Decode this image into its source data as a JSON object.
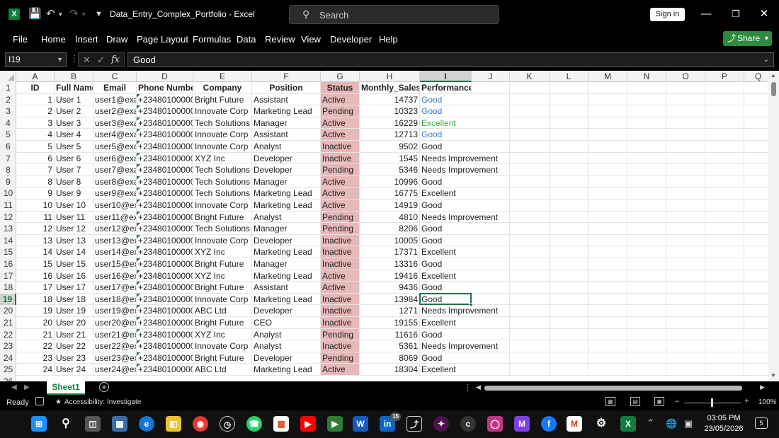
{
  "window": {
    "title": "Data_Entry_Complex_Portfolio  -  Excel",
    "search_placeholder": "Search",
    "signin_label": "Sign in"
  },
  "ribbon": {
    "tabs": [
      "File",
      "Home",
      "Insert",
      "Draw",
      "Page Layout",
      "Formulas",
      "Data",
      "Review",
      "View",
      "Developer",
      "Help"
    ],
    "share_label": "Share"
  },
  "formula_bar": {
    "name_box": "I19",
    "formula": "Good"
  },
  "columns": [
    "A",
    "B",
    "C",
    "D",
    "E",
    "F",
    "G",
    "H",
    "I",
    "J",
    "K",
    "L",
    "M",
    "N",
    "O",
    "P",
    "Q"
  ],
  "selected_column": "I",
  "selected_row": 19,
  "headers": [
    "ID",
    "Full Name",
    "Email",
    "Phone Number",
    "Company",
    "Position",
    "Status",
    "Monthly_Sales",
    "Performance"
  ],
  "rows": [
    [
      "1",
      "User 1",
      "user1@exa",
      "+23480100000(",
      "Bright Future",
      "Assistant",
      "Active",
      "14737",
      "Good"
    ],
    [
      "2",
      "User 2",
      "user2@exa",
      "+23480100000(",
      "Innovate Corp",
      "Marketing Lead",
      "Pending",
      "10323",
      "Good"
    ],
    [
      "3",
      "User 3",
      "user3@exa",
      "+23480100000(",
      "Tech Solutions",
      "Manager",
      "Active",
      "16229",
      "Excellent"
    ],
    [
      "4",
      "User 4",
      "user4@exa",
      "+23480100000(",
      "Innovate Corp",
      "Assistant",
      "Active",
      "12713",
      "Good"
    ],
    [
      "5",
      "User 5",
      "user5@exa",
      "+23480100000(",
      "Innovate Corp",
      "Analyst",
      "Inactive",
      "9502",
      "Good"
    ],
    [
      "6",
      "User 6",
      "user6@exa",
      "+23480100000(",
      "XYZ Inc",
      "Developer",
      "Inactive",
      "1545",
      "Needs Improvement"
    ],
    [
      "7",
      "User 7",
      "user7@exa",
      "+23480100000(",
      "Tech Solutions",
      "Developer",
      "Pending",
      "5346",
      "Needs Improvement"
    ],
    [
      "8",
      "User 8",
      "user8@exa",
      "+23480100000(",
      "Tech Solutions",
      "Manager",
      "Active",
      "10996",
      "Good"
    ],
    [
      "9",
      "User 9",
      "user9@exa",
      "+23480100000(",
      "Tech Solutions",
      "Marketing Lead",
      "Active",
      "16775",
      "Excellent"
    ],
    [
      "10",
      "User 10",
      "user10@ex",
      "+23480100000:",
      "Innovate Corp",
      "Marketing Lead",
      "Active",
      "14919",
      "Good"
    ],
    [
      "11",
      "User 11",
      "user11@ex",
      "+23480100000:",
      "Bright Future",
      "Analyst",
      "Pending",
      "4810",
      "Needs Improvement"
    ],
    [
      "12",
      "User 12",
      "user12@ex",
      "+23480100000:",
      "Tech Solutions",
      "Manager",
      "Pending",
      "8206",
      "Good"
    ],
    [
      "13",
      "User 13",
      "user13@ex",
      "+23480100000:",
      "Innovate Corp",
      "Developer",
      "Inactive",
      "10005",
      "Good"
    ],
    [
      "14",
      "User 14",
      "user14@ex",
      "+23480100000:",
      "XYZ Inc",
      "Marketing Lead",
      "Inactive",
      "17371",
      "Excellent"
    ],
    [
      "15",
      "User 15",
      "user15@ex",
      "+23480100000:",
      "Bright Future",
      "Manager",
      "Inactive",
      "13316",
      "Good"
    ],
    [
      "16",
      "User 16",
      "user16@ex",
      "+23480100000:",
      "XYZ Inc",
      "Marketing Lead",
      "Active",
      "19416",
      "Excellent"
    ],
    [
      "17",
      "User 17",
      "user17@ex",
      "+23480100000:",
      "Bright Future",
      "Assistant",
      "Active",
      "9436",
      "Good"
    ],
    [
      "18",
      "User 18",
      "user18@ex",
      "+23480100000:",
      "Innovate Corp",
      "Marketing Lead",
      "Inactive",
      "13984",
      "Good"
    ],
    [
      "19",
      "User 19",
      "user19@ex",
      "+23480100000:",
      "ABC Ltd",
      "Developer",
      "Inactive",
      "1271",
      "Needs Improvement"
    ],
    [
      "20",
      "User 20",
      "user20@ex",
      "+23480100000:",
      "Bright Future",
      "CEO",
      "Inactive",
      "19155",
      "Excellent"
    ],
    [
      "21",
      "User 21",
      "user21@ex",
      "+23480100000:",
      "XYZ Inc",
      "Analyst",
      "Pending",
      "11616",
      "Good"
    ],
    [
      "22",
      "User 22",
      "user22@ex",
      "+23480100000:",
      "Innovate Corp",
      "Analyst",
      "Inactive",
      "5361",
      "Needs Improvement"
    ],
    [
      "23",
      "User 23",
      "user23@ex",
      "+23480100000:",
      "Bright Future",
      "Developer",
      "Pending",
      "8069",
      "Good"
    ],
    [
      "24",
      "User 24",
      "user24@ex",
      "+23480100000:",
      "ABC Ltd",
      "Marketing Lead",
      "Active",
      "18304",
      "Excellent"
    ]
  ],
  "performance_colors": {
    "Good_top": "#3b7dc4",
    "Excellent_top": "#3aa84a"
  },
  "status_fill": "#e6b8b7",
  "sheet_tabs": [
    "Sheet1"
  ],
  "status_bar": {
    "ready": "Ready",
    "accessibility": "Accessibility: Investigate",
    "zoom": "100%"
  },
  "taskbar": {
    "time": "03:05 PM",
    "date": "23/05/2026",
    "notifications": "5",
    "badge": "15"
  }
}
